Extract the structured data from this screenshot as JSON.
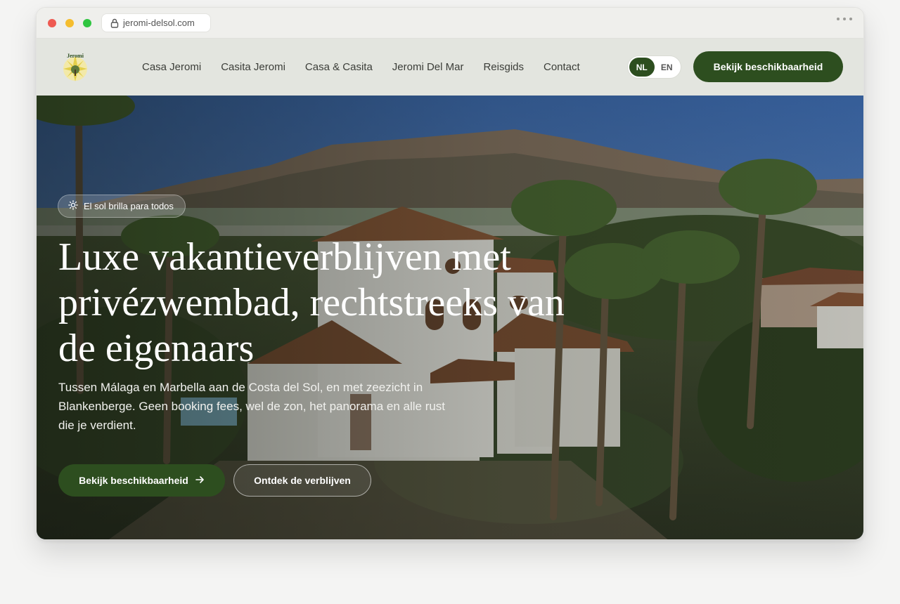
{
  "browser": {
    "url": "jeromi-delsol.com"
  },
  "header": {
    "logo_text": "Jeromi",
    "nav": [
      "Casa Jeromi",
      "Casita Jeromi",
      "Casa & Casita",
      "Jeromi Del Mar",
      "Reisgids",
      "Contact"
    ],
    "lang": {
      "active": "NL",
      "other": "EN"
    },
    "cta_label": "Bekijk beschikbaarheid"
  },
  "hero": {
    "badge": "El sol brilla para todos",
    "headline": "Luxe vakantieverblijven met privézwembad, rechtstreeks van de eigenaars",
    "subtext": "Tussen Málaga en Marbella aan de Costa del Sol, en met zeezicht in Blankenberge. Geen booking fees, wel de zon, het panorama en alle rust die je verdient.",
    "primary_cta": "Bekijk beschikbaarheid",
    "secondary_cta": "Ontdek de verblijven"
  },
  "colors": {
    "brand_green": "#2d4e1f",
    "header_bg": "#e3e5df"
  }
}
